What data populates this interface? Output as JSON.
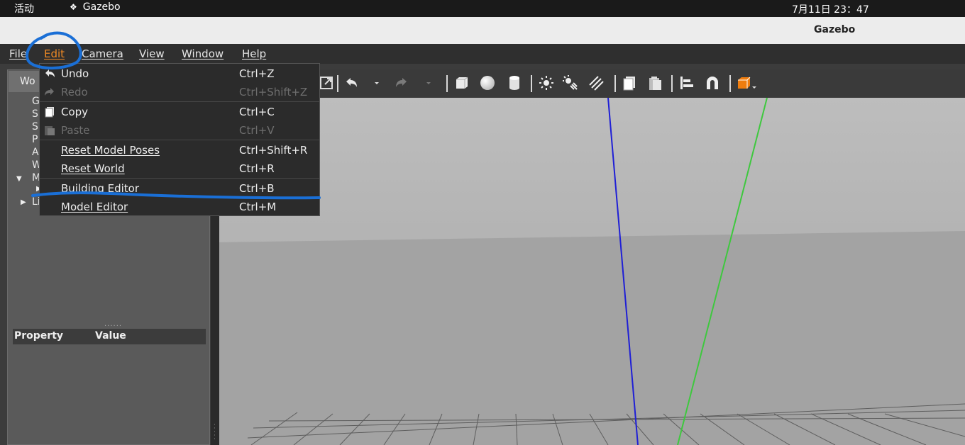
{
  "system_bar": {
    "activities": "活动",
    "app_name": "Gazebo",
    "clock": "7月11日  23：47"
  },
  "window": {
    "title": "Gazebo"
  },
  "menubar": {
    "file": "File",
    "edit": "Edit",
    "camera": "Camera",
    "view": "View",
    "window": "Window",
    "help": "Help"
  },
  "edit_menu": {
    "items": [
      {
        "label": "Undo",
        "shortcut": "Ctrl+Z",
        "enabled": true,
        "icon": "undo-icon"
      },
      {
        "label": "Redo",
        "shortcut": "Ctrl+Shift+Z",
        "enabled": false,
        "icon": "redo-icon"
      },
      {
        "label": "Copy",
        "shortcut": "Ctrl+C",
        "enabled": true,
        "icon": "copy-icon"
      },
      {
        "label": "Paste",
        "shortcut": "Ctrl+V",
        "enabled": false,
        "icon": "paste-icon"
      },
      {
        "label": "Reset Model Poses",
        "shortcut": "Ctrl+Shift+R",
        "enabled": true
      },
      {
        "label": "Reset World",
        "shortcut": "Ctrl+R",
        "enabled": true
      },
      {
        "label": "Building Editor",
        "shortcut": "Ctrl+B",
        "enabled": true
      },
      {
        "label": "Model Editor",
        "shortcut": "Ctrl+M",
        "enabled": true
      }
    ]
  },
  "left_panel": {
    "tab_world": "Wo",
    "tree_stubs": [
      "G",
      "S",
      "S",
      "P",
      "A",
      "W",
      "M",
      "Li"
    ],
    "splitter_dots": "......",
    "property_header": "Property",
    "value_header": "Value"
  },
  "toolbar": {
    "icons": [
      "scale-icon",
      "undo-icon",
      "undo-dropdown-icon",
      "redo-icon",
      "redo-dropdown-icon",
      "box-icon",
      "sphere-icon",
      "cylinder-icon",
      "point-light-icon",
      "spot-light-icon",
      "directional-light-icon",
      "copy-icon",
      "paste-icon",
      "align-icon",
      "snap-icon",
      "view-angle-icon"
    ]
  },
  "colors": {
    "accent": "#f08a24",
    "annotation": "#1a6fd6",
    "x_axis": "#1f1fd6",
    "y_axis": "#3ec83e"
  }
}
